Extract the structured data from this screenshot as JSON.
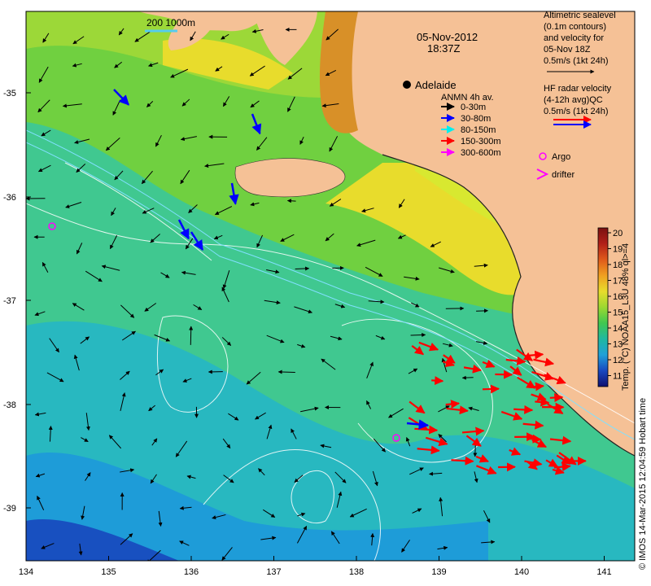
{
  "title": {
    "date": "05-Nov-2012",
    "time": "18:37Z"
  },
  "scale_bar": {
    "label": "200  1000m",
    "color": "#55ccee"
  },
  "city": {
    "name": "Adelaide"
  },
  "legend_alt": {
    "lines": [
      "Altimetric sealevel",
      "(0.1m contours)",
      "and velocity for",
      "05-Nov 18Z",
      "0.5m/s (1kt 24h)"
    ]
  },
  "legend_hf": {
    "lines": [
      "HF radar velocity",
      "(4-12h avg)QC",
      "0.5m/s (1kt 24h)"
    ],
    "colors": [
      "#ff0000",
      "#0000ff"
    ]
  },
  "legend_anmn": {
    "title": "ANMN 4h av.",
    "items": [
      {
        "label": "0-30m",
        "color": "#000000"
      },
      {
        "label": "30-80m",
        "color": "#0000ff"
      },
      {
        "label": "80-150m",
        "color": "#00eeee"
      },
      {
        "label": "150-300m",
        "color": "#ff0000"
      },
      {
        "label": "300-600m",
        "color": "#ff00ff"
      }
    ]
  },
  "legend_markers": {
    "argo": "Argo",
    "drifter": "drifter",
    "color": "#ff00ff"
  },
  "colorbar": {
    "ticks": [
      "20",
      "19",
      "18",
      "17",
      "16",
      "15",
      "14",
      "13",
      "12",
      "11"
    ],
    "label": "Temp. (°C) NOAA15_L3U 48% ql>=4",
    "colors": [
      "#7a1010",
      "#b22018",
      "#d8401a",
      "#ee7a1c",
      "#f0b020",
      "#e8dc2c",
      "#b8e030",
      "#60cc30",
      "#20c060",
      "#20b8a0",
      "#20a8d8",
      "#2070d8",
      "#1830b0",
      "#101070"
    ]
  },
  "credit": "© IMOS 14-Mar-2015 12:04:59 Hobart time",
  "x_axis": {
    "ticks": [
      "134",
      "135",
      "136",
      "137",
      "138",
      "139",
      "140",
      "141"
    ]
  },
  "y_axis": {
    "ticks": [
      "-35",
      "-36",
      "-37",
      "-38",
      "-39"
    ]
  },
  "colors": {
    "land": "#f5c196",
    "ocean_deep": "#20a8d8",
    "ocean_mid": "#40c890",
    "ocean_shelf": "#70d040",
    "warm": "#e8dc2c",
    "contour": "#ffffff"
  }
}
